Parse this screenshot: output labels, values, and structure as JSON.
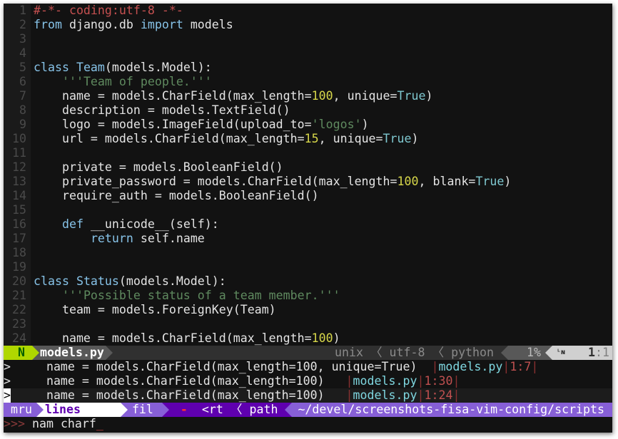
{
  "editor": {
    "lines": [
      {
        "num": "1",
        "tokens": [
          [
            "c",
            "#-*- coding:utf-8 -*-"
          ]
        ]
      },
      {
        "num": "2",
        "tokens": [
          [
            "k",
            "from"
          ],
          [
            "",
            " django.db "
          ],
          [
            "k",
            "import"
          ],
          [
            "",
            " models"
          ]
        ]
      },
      {
        "num": "3",
        "tokens": []
      },
      {
        "num": "4",
        "tokens": []
      },
      {
        "num": "5",
        "tokens": [
          [
            "k",
            "class"
          ],
          [
            "",
            " "
          ],
          [
            "f",
            "Team"
          ],
          [
            "",
            "(models.Model):"
          ]
        ]
      },
      {
        "num": "6",
        "tokens": [
          [
            "",
            "    "
          ],
          [
            "s",
            "'''Team of people.'''"
          ]
        ]
      },
      {
        "num": "7",
        "tokens": [
          [
            "",
            "    name = models.CharField(max_length="
          ],
          [
            "n",
            "100"
          ],
          [
            "",
            ", unique="
          ],
          [
            "b",
            "True"
          ],
          [
            "",
            ")"
          ]
        ]
      },
      {
        "num": "8",
        "tokens": [
          [
            "",
            "    description = models.TextField()"
          ]
        ]
      },
      {
        "num": "9",
        "tokens": [
          [
            "",
            "    logo = models.ImageField(upload_to="
          ],
          [
            "s",
            "'logos'"
          ],
          [
            "",
            ")"
          ]
        ]
      },
      {
        "num": "10",
        "tokens": [
          [
            "",
            "    url = models.CharField(max_length="
          ],
          [
            "n",
            "15"
          ],
          [
            "",
            ", unique="
          ],
          [
            "b",
            "True"
          ],
          [
            "",
            ")"
          ]
        ]
      },
      {
        "num": "11",
        "tokens": []
      },
      {
        "num": "12",
        "tokens": [
          [
            "",
            "    private = models.BooleanField()"
          ]
        ]
      },
      {
        "num": "13",
        "tokens": [
          [
            "",
            "    private_password = models.CharField(max_length="
          ],
          [
            "n",
            "100"
          ],
          [
            "",
            ", blank="
          ],
          [
            "b",
            "True"
          ],
          [
            "",
            ")"
          ]
        ]
      },
      {
        "num": "14",
        "tokens": [
          [
            "",
            "    require_auth = models.BooleanField()"
          ]
        ]
      },
      {
        "num": "15",
        "tokens": []
      },
      {
        "num": "16",
        "tokens": [
          [
            "",
            "    "
          ],
          [
            "k",
            "def"
          ],
          [
            "",
            " __unicode__(self):"
          ]
        ]
      },
      {
        "num": "17",
        "tokens": [
          [
            "",
            "        "
          ],
          [
            "k",
            "return"
          ],
          [
            "",
            " self.name"
          ]
        ]
      },
      {
        "num": "18",
        "tokens": []
      },
      {
        "num": "19",
        "tokens": []
      },
      {
        "num": "20",
        "tokens": [
          [
            "k",
            "class"
          ],
          [
            "",
            " "
          ],
          [
            "f",
            "Status"
          ],
          [
            "",
            "(models.Model):"
          ]
        ]
      },
      {
        "num": "21",
        "tokens": [
          [
            "",
            "    "
          ],
          [
            "s",
            "'''Possible status of a team member.'''"
          ]
        ]
      },
      {
        "num": "22",
        "tokens": [
          [
            "",
            "    team = models.ForeignKey(Team)"
          ]
        ]
      },
      {
        "num": "23",
        "tokens": []
      },
      {
        "num": "24",
        "tokens": [
          [
            "",
            "    name = models.CharField(max_length="
          ],
          [
            "n",
            "100"
          ],
          [
            "",
            ")"
          ]
        ]
      }
    ]
  },
  "statusline": {
    "mode": "N",
    "filename": "models.py",
    "fileformat": "unix",
    "encoding": "utf-8",
    "filetype": "python",
    "percent": "1%",
    "line_icon": "line-number-icon",
    "line": "1",
    "col": ":1",
    "colors": {
      "mode_bg": "#afd700",
      "mode_fg": "#005f00",
      "file_bg": "#585858",
      "mid_bg": "#303030",
      "pos_bg": "#d0d0d0"
    }
  },
  "results": [
    {
      "marker": ">",
      "text": "    name = models.CharField(max_length=100, unique=True)  ",
      "file": "models.py",
      "pos": "1:7",
      "selected": false
    },
    {
      "marker": ">",
      "text": "    name = models.CharField(max_length=100)   ",
      "file": "models.py",
      "pos": "1:30",
      "selected": false
    },
    {
      "marker": ">",
      "text": "    name = models.CharField(max_length=100)   ",
      "file": "models.py",
      "pos": "1:24",
      "selected": true
    }
  ],
  "ctrlp": {
    "prev": "mru",
    "current": "lines",
    "next": "fil",
    "regex_flag": "-",
    "mode": "<rt",
    "by": "path",
    "cwd": "~/devel/screenshots-fisa-vim-config/scripts",
    "colors": {
      "light": "#875fd7",
      "dark": "#5f00af"
    }
  },
  "prompt": {
    "symbol": ">>>",
    "input": "nam charf",
    "cursor": "_"
  }
}
